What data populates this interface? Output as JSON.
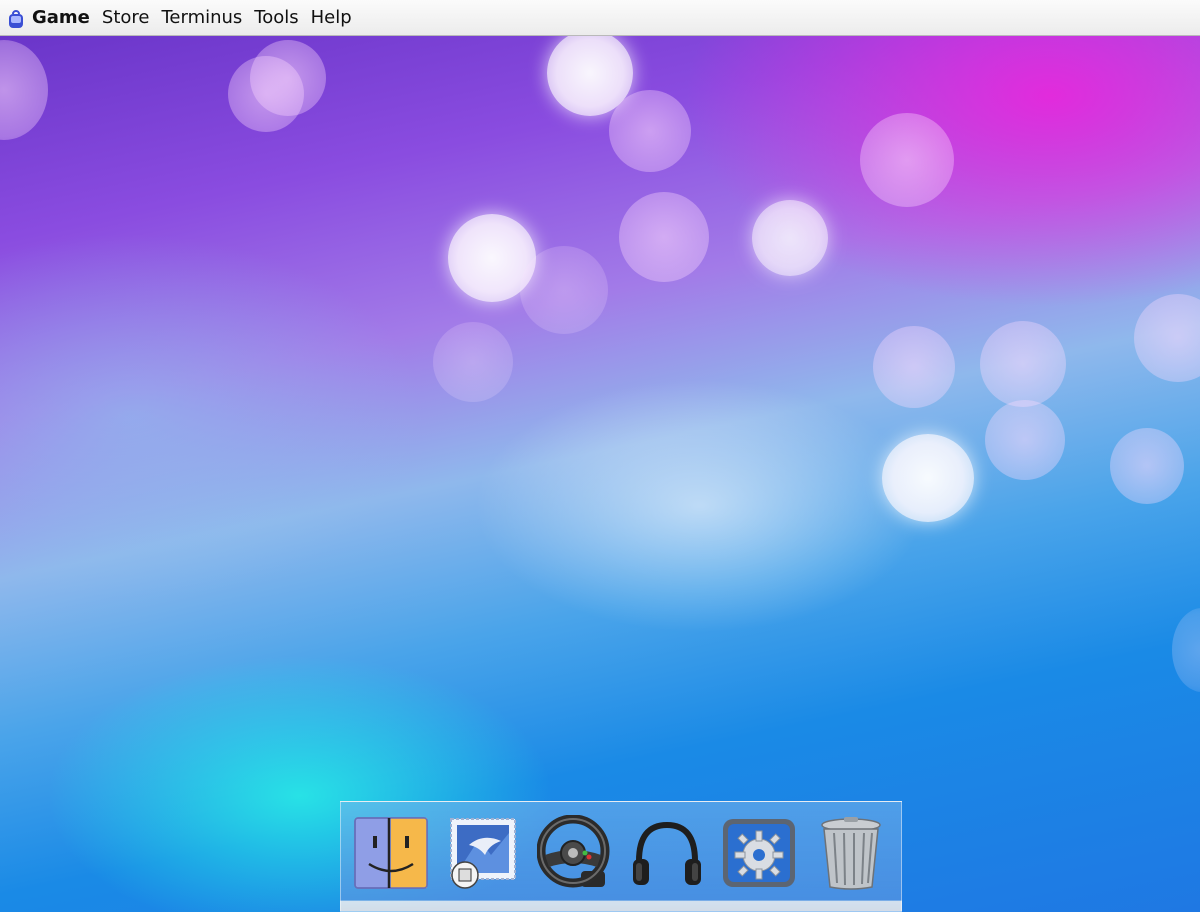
{
  "menubar": {
    "app_name": "Game",
    "items": [
      "Store",
      "Terminus",
      "Tools",
      "Help"
    ]
  },
  "desktop": {
    "wallpaper": "purple-blue-cyan bokeh",
    "colors": {
      "purple": "#6a35c9",
      "magenta": "#e028dc",
      "blue": "#1f78e3",
      "cyan": "#28f0e6"
    }
  },
  "dock": {
    "items": [
      {
        "icon": "finder-icon"
      },
      {
        "icon": "mail-stamp-icon"
      },
      {
        "icon": "steering-wheel-icon"
      },
      {
        "icon": "headphones-icon"
      },
      {
        "icon": "system-preferences-gear-icon"
      },
      {
        "icon": "trash-can-icon"
      }
    ]
  }
}
